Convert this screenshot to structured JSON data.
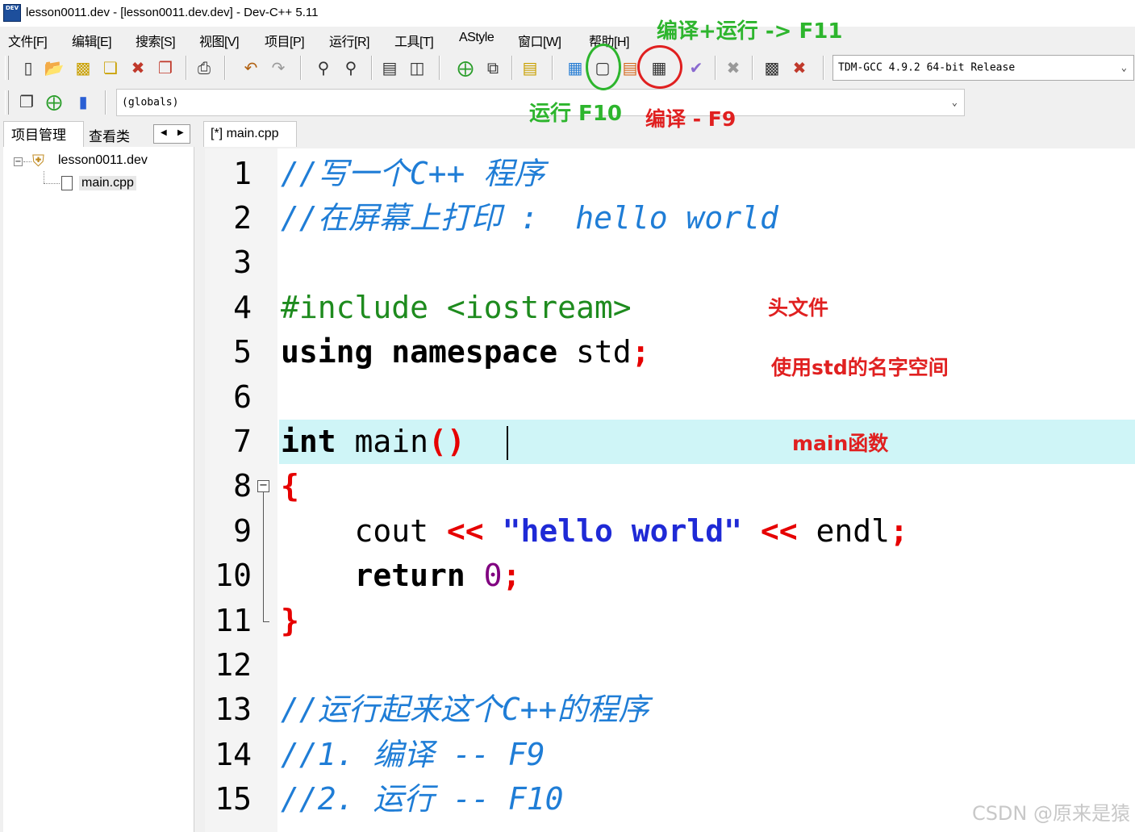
{
  "window": {
    "title": "lesson0011.dev - [lesson0011.dev.dev] - Dev-C++ 5.11",
    "app_icon_text": "DEV"
  },
  "menu": [
    "文件[F]",
    "编辑[E]",
    "搜索[S]",
    "视图[V]",
    "项目[P]",
    "运行[R]",
    "工具[T]",
    "AStyle",
    "窗口[W]",
    "帮助[H]"
  ],
  "toolbar": {
    "compiler_select": "TDM-GCC 4.9.2 64-bit Release",
    "scope_select": "(globals)"
  },
  "left_panel": {
    "tabs": [
      "项目管理",
      "查看类"
    ],
    "tree": {
      "project": "lesson0011.dev",
      "file": "main.cpp"
    }
  },
  "editor": {
    "tab_label": "[*] main.cpp",
    "line_numbers": [
      "1",
      "2",
      "3",
      "4",
      "5",
      "6",
      "7",
      "8",
      "9",
      "10",
      "11",
      "12",
      "13",
      "14",
      "15"
    ],
    "highlighted_line": 7,
    "code": {
      "l1": "//写一个C++ 程序",
      "l2": "//在屏幕上打印 :  hello world",
      "l4": "#include <iostream>",
      "l5a": "using namespace",
      "l5b": " std",
      "l5c": ";",
      "l7a": "int",
      "l7b": " main",
      "l7c": "()",
      "l8": "{",
      "l9a": "    cout ",
      "l9b": "<<",
      "l9c": " ",
      "l9d": "\"hello world\"",
      "l9e": " ",
      "l9f": "<<",
      "l9g": " endl",
      "l9h": ";",
      "l10a": "    return ",
      "l10b": "0",
      "l10c": ";",
      "l11": "}",
      "l13": "//运行起来这个C++的程序",
      "l14": "//1. 编译 -- F9",
      "l15": "//2. 运行 -- F10"
    }
  },
  "annotations": {
    "compile_run": "编译+运行 -> F11",
    "run": "运行 F10",
    "compile": "编译 - F9",
    "header": "头文件",
    "namespace": "使用std的名字空间",
    "main_fn": "main函数"
  },
  "colors": {
    "comment": "#1f7dd6",
    "preprocessor": "#1e8b1e",
    "operator": "#e60000",
    "string": "#1f2ad6",
    "number": "#800080",
    "current_line": "#cff5f7",
    "annotation_green": "#2db52d",
    "annotation_red": "#e02020"
  },
  "watermark": "CSDN @原来是猿"
}
